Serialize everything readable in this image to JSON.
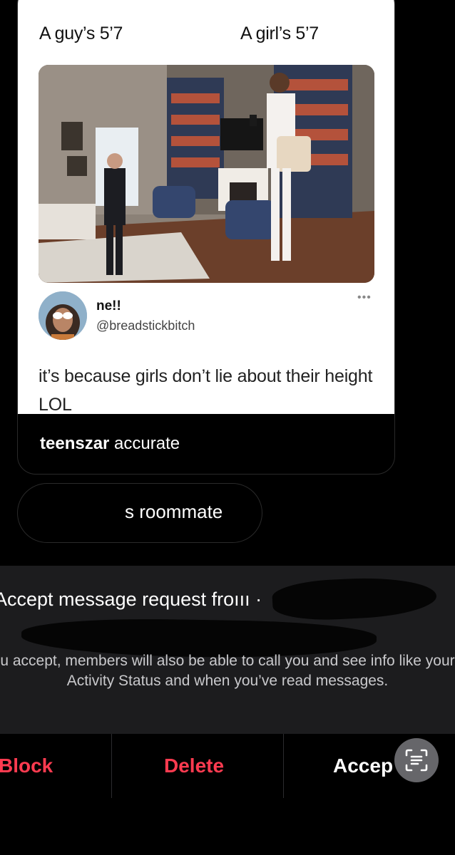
{
  "post": {
    "caption_left": "A guy’s 5’7",
    "caption_right": "A girl’s 5’7",
    "tweet": {
      "display_name": "ne!!",
      "handle": "@breadstickbitch",
      "more_icon": "•••",
      "text": "it’s because girls don’t lie about their height LOL"
    },
    "reply": {
      "username": "teenszar",
      "text": " accurate"
    }
  },
  "roommate_message": {
    "text": "s roommate"
  },
  "request": {
    "title": "Accept message request froııı ·",
    "body": "u accept, members will also be able to call you and see info like your Activity Status and when you’ve read messages."
  },
  "actions": {
    "block_label": "Block",
    "delete_label": "Delete",
    "accept_label": "Accep",
    "block_color": "#ff3b50",
    "delete_color": "#ff3b50",
    "accept_color": "#ffffff"
  },
  "icons": {
    "scan": "text-scan-icon"
  }
}
